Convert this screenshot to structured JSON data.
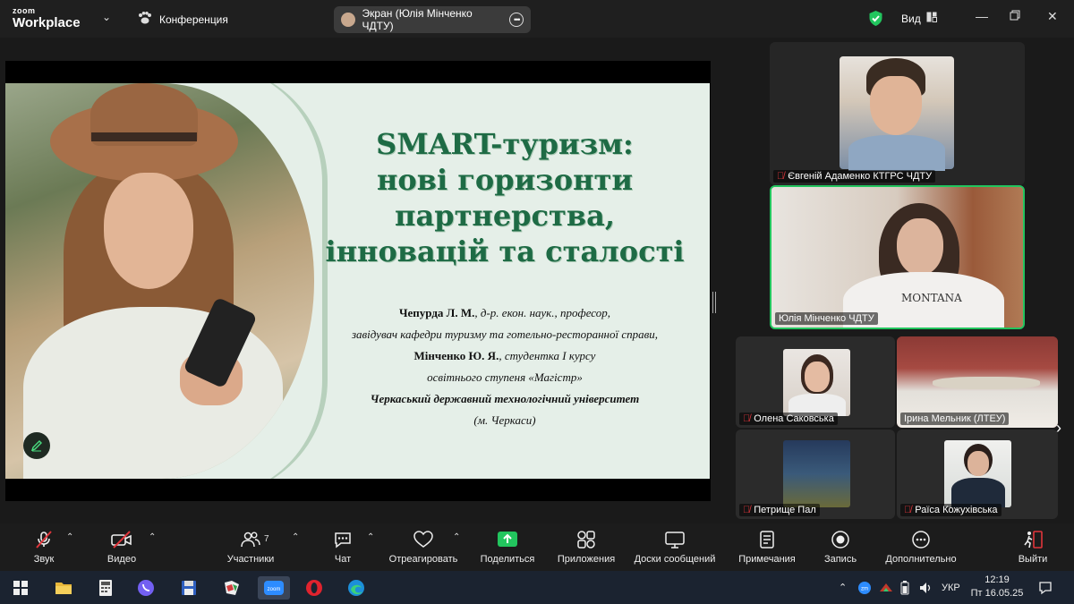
{
  "app": {
    "brand_top": "zoom",
    "brand_bottom": "Workplace",
    "conference": "Конференция"
  },
  "share": {
    "label": "Экран (Юлія Мінченко ЧДТУ)"
  },
  "view": {
    "label": "Вид"
  },
  "slide": {
    "title_lines": [
      "SMART-туризм:",
      "нові горизонти",
      "партнерства,",
      "інновацій та сталості"
    ],
    "line1_bold": "Чепурда Л. М.",
    "line1_rest": ", д-р. екон. наук., професор,",
    "line2": "завідувач кафедри туризму та готельно-ресторанної справи,",
    "line3_bold": "Мінченко Ю. Я.",
    "line3_rest": ", студентка І курсу",
    "line4": "освітнього ступеня «Магістр»",
    "line5": "Черкаський державний технологічний університет",
    "line6": "(м. Черкаси)"
  },
  "participants": {
    "p1": "Євгеній Адаменко КТГРС ЧДТУ",
    "p2": "Юлія Мінченко ЧДТУ",
    "p2_shirt": "MONTANA",
    "p3": "Олена Саковська",
    "p4": "Ірина Мельник  (ЛТЕУ)",
    "p5": "Петрище Пал",
    "p6": "Раїса Кожухівська"
  },
  "toolbar": {
    "audio": "Звук",
    "video": "Видео",
    "participants": "Участники",
    "participants_count": "7",
    "chat": "Чат",
    "react": "Отреагировать",
    "share": "Поделиться",
    "apps": "Приложения",
    "whiteboards": "Доски сообщений",
    "notes": "Примечания",
    "record": "Запись",
    "more": "Дополнительно",
    "leave": "Выйти"
  },
  "taskbar": {
    "lang": "УКР",
    "time": "12:19",
    "date": "Пт 16.05.25"
  },
  "colors": {
    "accent_green": "#22c55e",
    "slide_title": "#1e6b45",
    "mic_off": "#e0353b",
    "leave": "#e0353b"
  }
}
